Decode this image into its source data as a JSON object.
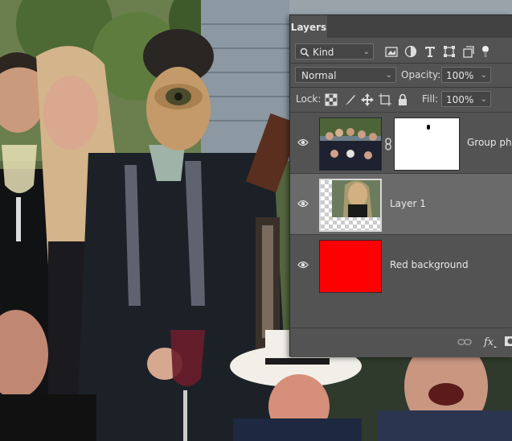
{
  "panel": {
    "tab_label": "Layers",
    "filter": {
      "value": "Kind"
    },
    "blend_mode": "Normal",
    "opacity_label": "Opacity:",
    "opacity_value": "100%",
    "lock_label": "Lock:",
    "fill_label": "Fill:",
    "fill_value": "100%",
    "layers": [
      {
        "name": "Group pho",
        "visible": true,
        "has_mask": true,
        "kind": "photo"
      },
      {
        "name": "Layer 1",
        "visible": true,
        "selected": true,
        "kind": "transparent-face"
      },
      {
        "name": "Red background",
        "visible": true,
        "kind": "solid",
        "color": "#ff0000"
      }
    ],
    "footer_icons": [
      "link-icon",
      "fx-icon",
      "mask-icon"
    ]
  },
  "colors": {
    "panel_bg": "#535353",
    "selected_row": "#6a6a6a",
    "red_fill": "#ff0000"
  }
}
